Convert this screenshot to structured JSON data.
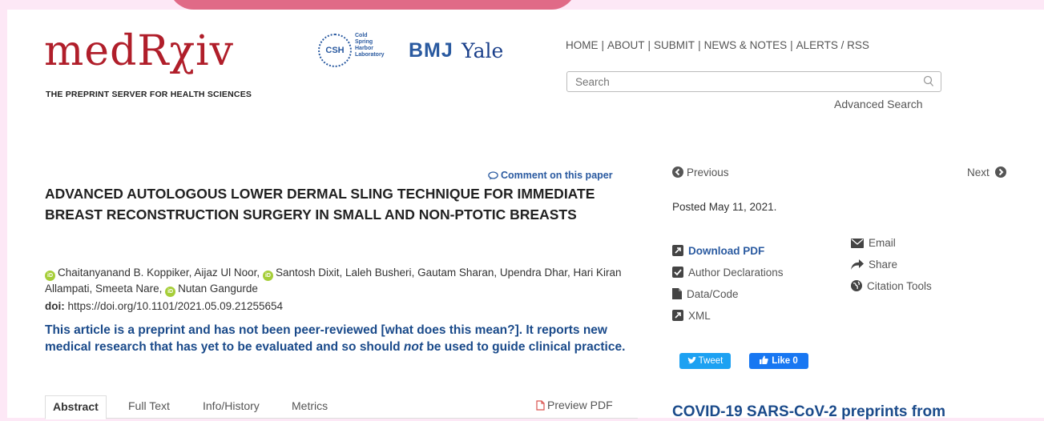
{
  "header": {
    "logo_text": "medRχiv",
    "logo_tagline": "THE PREPRINT SERVER FOR HEALTH SCIENCES",
    "partners": {
      "csh_seal": "CSH",
      "csh_text": "Cold Spring Harbor Laboratory",
      "bmj": "BMJ",
      "yale": "Yale"
    },
    "nav": [
      "HOME",
      "ABOUT",
      "SUBMIT",
      "NEWS & NOTES",
      "ALERTS / RSS"
    ],
    "search_placeholder": "Search",
    "advanced_search": "Advanced Search"
  },
  "article": {
    "comment_link": "Comment on this paper",
    "title": "ADVANCED AUTOLOGOUS LOWER DERMAL SLING TECHNIQUE FOR IMMEDIATE BREAST RECONSTRUCTION SURGERY IN SMALL AND NON-PTOTIC BREASTS",
    "authors": [
      {
        "name": "Chaitanyanand B. Koppiker",
        "orcid": true
      },
      {
        "name": "Aijaz Ul Noor",
        "orcid": false
      },
      {
        "name": "Santosh Dixit",
        "orcid": true
      },
      {
        "name": "Laleh Busheri",
        "orcid": false
      },
      {
        "name": "Gautam Sharan",
        "orcid": false
      },
      {
        "name": "Upendra Dhar",
        "orcid": false
      },
      {
        "name": "Hari Kiran Allampati",
        "orcid": false
      },
      {
        "name": "Smeeta Nare",
        "orcid": false
      },
      {
        "name": "Nutan Gangurde",
        "orcid": true
      }
    ],
    "orcid_glyph": "iD",
    "doi_label": "doi:",
    "doi": "https://doi.org/10.1101/2021.05.09.21255654",
    "notice_part1": "This article is a preprint and has not been peer-reviewed [what does this mean?]. It reports new medical research that has yet to be evaluated and so should ",
    "notice_em": "not",
    "notice_part2": " be used to guide clinical practice.",
    "tabs": [
      "Abstract",
      "Full Text",
      "Info/History",
      "Metrics"
    ],
    "active_tab": "Abstract",
    "preview_pdf": "Preview PDF"
  },
  "sidebar": {
    "previous": "Previous",
    "next": "Next",
    "posted": "Posted May 11, 2021.",
    "links_left": [
      {
        "label": "Download PDF",
        "icon": "external-link-icon"
      },
      {
        "label": "Author Declarations",
        "icon": "checkbox-icon"
      },
      {
        "label": "Data/Code",
        "icon": "file-icon"
      },
      {
        "label": "XML",
        "icon": "external-link-icon"
      }
    ],
    "links_right": [
      {
        "label": "Email",
        "icon": "envelope-icon"
      },
      {
        "label": "Share",
        "icon": "share-icon"
      },
      {
        "label": "Citation Tools",
        "icon": "globe-icon"
      }
    ],
    "tweet": "Tweet",
    "like": "Like 0",
    "covid_heading": "COVID-19 SARS-CoV-2 preprints from"
  },
  "colors": {
    "brand_red": "#b01e2a",
    "link_blue": "#2a5aa0",
    "notice_blue": "#1a4a8a",
    "orcid_green": "#a6ce39",
    "page_bg": "#fde8f6"
  }
}
